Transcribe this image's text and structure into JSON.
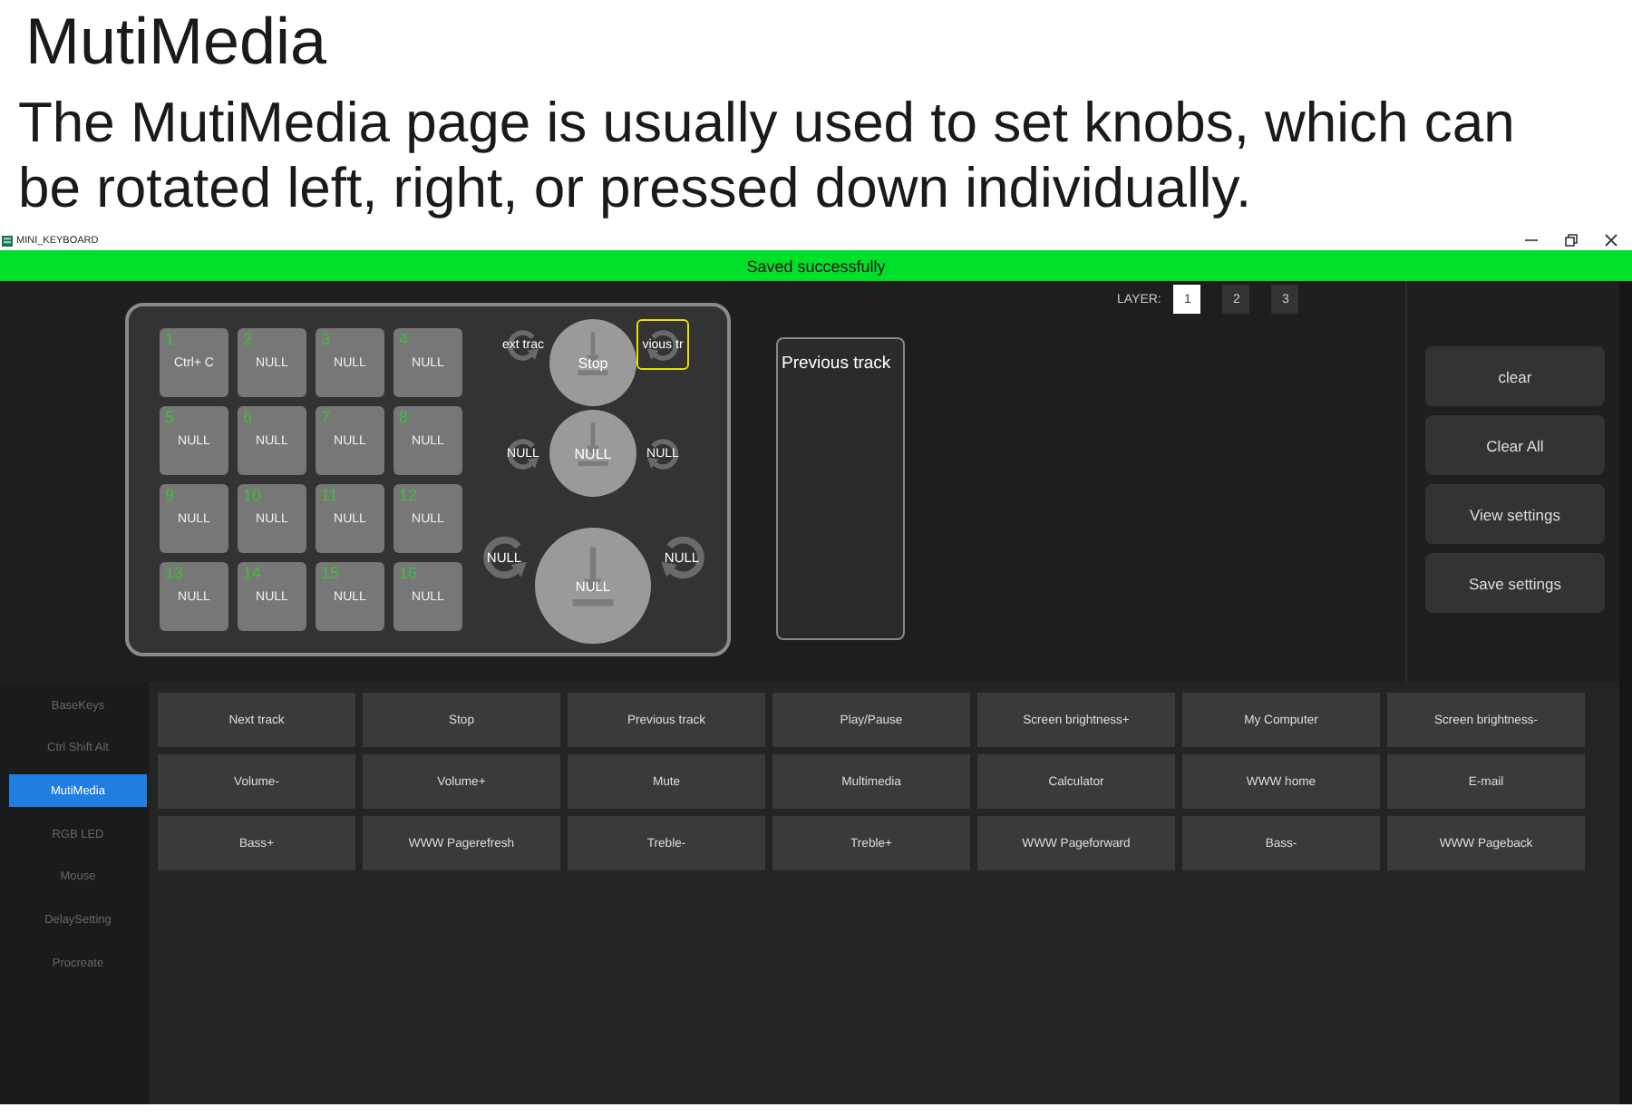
{
  "caption": {
    "heading": "MutiMedia",
    "text": "The MutiMedia page is usually used to set knobs, which can be rotated left, right, or pressed down individually."
  },
  "window": {
    "title": "MINI_KEYBOARD"
  },
  "status_bar": {
    "message": "Saved successfully"
  },
  "layers": {
    "label": "LAYER:",
    "items": [
      {
        "label": "1",
        "selected": true
      },
      {
        "label": "2",
        "selected": false
      },
      {
        "label": "3",
        "selected": false
      }
    ]
  },
  "keys": [
    {
      "number": "1",
      "label": "Ctrl+ C",
      "selected": false
    },
    {
      "number": "2",
      "label": "NULL",
      "selected": false
    },
    {
      "number": "3",
      "label": "NULL",
      "selected": false
    },
    {
      "number": "4",
      "label": "NULL",
      "selected": false
    },
    {
      "number": "5",
      "label": "NULL",
      "selected": false
    },
    {
      "number": "6",
      "label": "NULL",
      "selected": false
    },
    {
      "number": "7",
      "label": "NULL",
      "selected": false
    },
    {
      "number": "8",
      "label": "NULL",
      "selected": false
    },
    {
      "number": "9",
      "label": "NULL",
      "selected": false
    },
    {
      "number": "10",
      "label": "NULL",
      "selected": false
    },
    {
      "number": "11",
      "label": "NULL",
      "selected": false
    },
    {
      "number": "12",
      "label": "NULL",
      "selected": false
    },
    {
      "number": "13",
      "label": "NULL",
      "selected": false
    },
    {
      "number": "14",
      "label": "NULL",
      "selected": false
    },
    {
      "number": "15",
      "label": "NULL",
      "selected": false
    },
    {
      "number": "16",
      "label": "NULL",
      "selected": false
    }
  ],
  "knobs": [
    {
      "kind": "small",
      "rotate_left": {
        "label": "ext trac",
        "selected": false
      },
      "press": {
        "label": "Stop",
        "selected": false
      },
      "rotate_right": {
        "label": "vious tr",
        "selected": true
      }
    },
    {
      "kind": "small",
      "rotate_left": {
        "label": "NULL",
        "selected": false
      },
      "press": {
        "label": "NULL",
        "selected": false
      },
      "rotate_right": {
        "label": "NULL",
        "selected": false
      }
    },
    {
      "kind": "large",
      "rotate_left": {
        "label": "NULL",
        "selected": false
      },
      "press": {
        "label": "NULL",
        "selected": false
      },
      "rotate_right": {
        "label": "NULL",
        "selected": false
      }
    }
  ],
  "preview": {
    "text": "Previous track"
  },
  "actions": [
    "clear",
    "Clear All",
    "View settings",
    "Save settings"
  ],
  "sidebar": {
    "items": [
      {
        "label": "BaseKeys",
        "selected": false
      },
      {
        "label": "Ctrl Shift Alt",
        "selected": false
      },
      {
        "label": "MutiMedia",
        "selected": true
      },
      {
        "label": "RGB LED",
        "selected": false
      },
      {
        "label": "Mouse",
        "selected": false
      },
      {
        "label": "DelaySetting",
        "selected": false
      },
      {
        "label": "Procreate",
        "selected": false
      }
    ]
  },
  "functions": [
    "Next track",
    "Stop",
    "Previous track",
    "Play/Pause",
    "Screen brightness+",
    "My Computer",
    "Screen brightness-",
    "Volume-",
    "Volume+",
    "Mute",
    "Multimedia",
    "Calculator",
    "WWW home",
    "E-mail",
    "Bass+",
    "WWW Pagerefresh",
    "Treble-",
    "Treble+",
    "WWW Pageforward",
    "Bass-",
    "WWW Pageback"
  ]
}
